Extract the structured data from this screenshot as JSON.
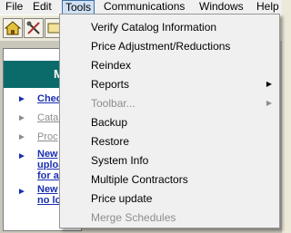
{
  "menubar": {
    "items": [
      "File",
      "Edit",
      "Tools",
      "Communications",
      "Windows",
      "Help"
    ]
  },
  "panel": {
    "heading": "M",
    "links": [
      {
        "lines": [
          "Chec"
        ]
      },
      {
        "lines": [
          "Catal"
        ]
      },
      {
        "lines": [
          "Proc"
        ]
      },
      {
        "lines": [
          "New",
          "uploa",
          "for a"
        ]
      },
      {
        "lines": [
          "New",
          "no lo"
        ]
      }
    ]
  },
  "tools_menu": {
    "items": [
      {
        "label": "Verify Catalog Information",
        "enabled": true,
        "submenu": false
      },
      {
        "label": "Price Adjustment/Reductions",
        "enabled": true,
        "submenu": false
      },
      {
        "label": "Reindex",
        "enabled": true,
        "submenu": false
      },
      {
        "label": "Reports",
        "enabled": true,
        "submenu": true
      },
      {
        "label": "Toolbar...",
        "enabled": false,
        "submenu": true
      },
      {
        "label": "Backup",
        "enabled": true,
        "submenu": false
      },
      {
        "label": "Restore",
        "enabled": true,
        "submenu": false
      },
      {
        "label": "System Info",
        "enabled": true,
        "submenu": false
      },
      {
        "label": "Multiple Contractors",
        "enabled": true,
        "submenu": false
      },
      {
        "label": "Price update",
        "enabled": true,
        "submenu": false
      },
      {
        "label": "Merge Schedules",
        "enabled": false,
        "submenu": false
      }
    ],
    "submenu_glyph": "▶"
  },
  "colors": {
    "panel_header": "#0b6b6b",
    "link": "#1a2fb0",
    "disabled": "#8d8d8d"
  }
}
